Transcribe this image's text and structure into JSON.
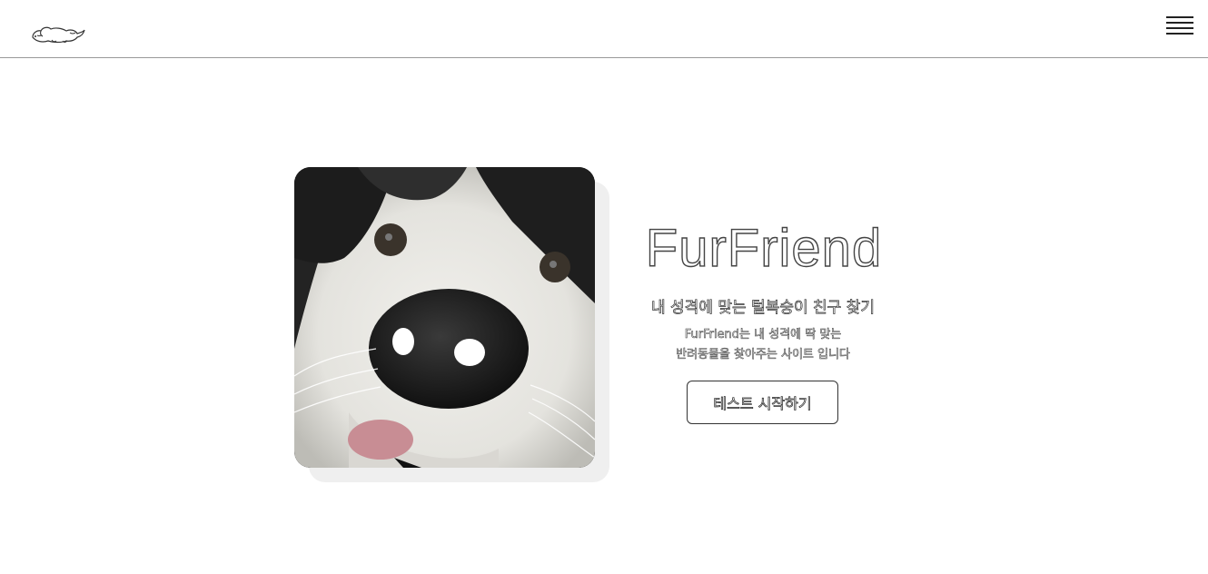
{
  "header": {
    "logo_icon": "sleeping-dog-logo-icon",
    "menu_icon": "hamburger-menu-icon"
  },
  "hero": {
    "image_alt": "close-up of a black and white dog's nose",
    "title": "FurFriend",
    "subtitle": "내 성격에 맞는 털복숭이 친구 찾기",
    "description_line1": "FurFriend는 내 성격에 딱 맞는",
    "description_line2": "반려동물을 찾아주는 사이트 입니다",
    "cta_label": "테스트 시작하기"
  },
  "colors": {
    "background": "#ffffff",
    "header_border": "#9a9a9a",
    "text_outline": "#333333",
    "photo_shadow": "#efefef"
  }
}
